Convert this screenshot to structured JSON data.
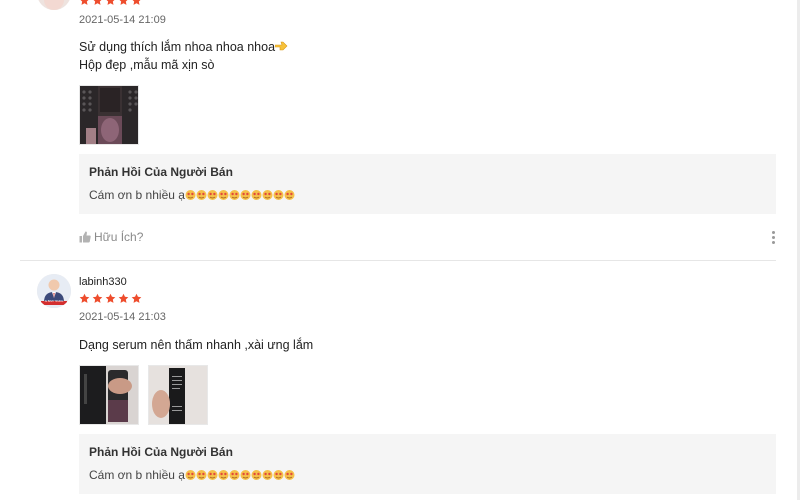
{
  "reviews": [
    {
      "username": "",
      "rating": 5,
      "timestamp": "2021-05-14 21:09",
      "comment_lines": [
        "Sử dụng thích lắm nhoa nhoa nhoa",
        "Hộp đẹp ,mẫu mã xịn sò"
      ],
      "comment_emoji": "pointing-hand-icon",
      "images": [
        "product-photo-dark-bottle"
      ],
      "seller_reply": {
        "title": "Phản Hồi Của Người Bán",
        "text": "Cám ơn b nhiều ạ",
        "emoji": "love-face-emoji",
        "emoji_count": 10
      },
      "helpful_label": "Hữu Ích?"
    },
    {
      "username": "labinh330",
      "avatar_caption": "AI BÌNH TRUNG",
      "rating": 5,
      "timestamp": "2021-05-14 21:03",
      "comment_lines": [
        "Dạng serum nên thấm nhanh ,xài ưng lắm"
      ],
      "images": [
        "product-photo-bottle-hand",
        "product-photo-box-back"
      ],
      "seller_reply": {
        "title": "Phản Hồi Của Người Bán",
        "text": "Cám ơn b nhiều ạ",
        "emoji": "love-face-emoji",
        "emoji_count": 10
      }
    }
  ],
  "colors": {
    "star": "#ee4d2d",
    "reply_bg": "#f5f5f5",
    "muted_text": "#8a8a8a"
  }
}
